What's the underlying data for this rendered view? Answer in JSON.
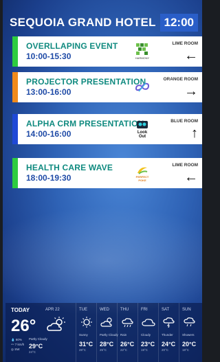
{
  "header": {
    "hotel_name": "SEQUOIA GRAND HOTEL",
    "clock": "12:00"
  },
  "events": [
    {
      "name": "OVERLLAPING EVENT",
      "time": "10:00-15:30",
      "room": "LIME ROOM",
      "arrow": "←",
      "color": "#2ecc40",
      "logo": "harmony-logo",
      "logo_text": "HARMONY"
    },
    {
      "name": "PROJECTOR PRESENTATION",
      "time": "13:00-16:00",
      "room": "ORANGE ROOM",
      "arrow": "→",
      "color": "#f08a1c",
      "logo": "infinity-logo"
    },
    {
      "name": "ALPHA CRM PRESENTATION",
      "time": "14:00-16:00",
      "room": "BLUE ROOM",
      "arrow": "↑",
      "color": "#1f49d6",
      "logo": "look-out-logo",
      "logo_text": "Look Out"
    },
    {
      "name": "HEALTH CARE WAVE",
      "time": "18:00-19:30",
      "room": "LIME ROOM",
      "arrow": "←",
      "color": "#2ecc40",
      "logo": "perfect-poke-logo",
      "logo_text": "PERFECT POKE"
    }
  ],
  "weather": {
    "today": {
      "label": "TODAY",
      "date": "APR 22",
      "temp": "26°",
      "condition": "Partly Cloudy",
      "humidity": "60%",
      "wind": "7 km/h",
      "uv": "SW",
      "hi": "29°C",
      "lo": "24°C"
    },
    "days": [
      {
        "name": "TUE",
        "condition": "Sunny",
        "hi": "31°C",
        "lo": "28°C",
        "icon": "sun-icon"
      },
      {
        "name": "WED",
        "condition": "Partly Cloudy",
        "hi": "28°C",
        "lo": "25°C",
        "icon": "partly-cloudy-icon"
      },
      {
        "name": "THU",
        "condition": "Rain",
        "hi": "26°C",
        "lo": "22°C",
        "icon": "rain-icon"
      },
      {
        "name": "FRI",
        "condition": "Cloudy",
        "hi": "23°C",
        "lo": "19°C",
        "icon": "cloud-icon"
      },
      {
        "name": "SAT",
        "condition": "Thunder",
        "hi": "24°C",
        "lo": "20°C",
        "icon": "thunder-icon"
      },
      {
        "name": "SUN",
        "condition": "Showers",
        "hi": "20°C",
        "lo": "18°C",
        "icon": "showers-icon"
      }
    ]
  }
}
